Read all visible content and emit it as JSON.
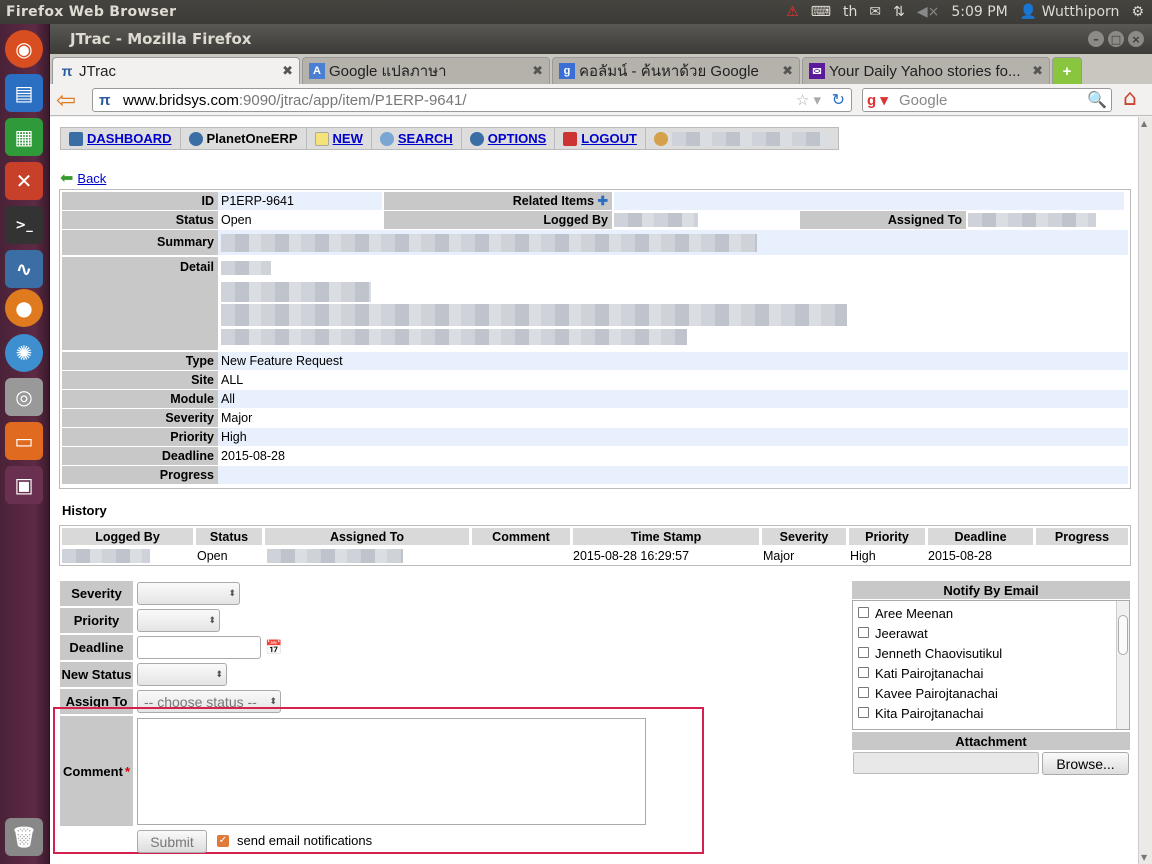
{
  "system": {
    "app_name": "Firefox Web Browser",
    "lang": "th",
    "time": "5:09 PM",
    "user": "Wutthiporn"
  },
  "window": {
    "title": "JTrac - Mozilla Firefox"
  },
  "tabs": [
    {
      "label": "JTrac",
      "icon": "jtrac-icon",
      "active": true
    },
    {
      "label": "Google แปลภาษา",
      "icon": "google-translate-icon"
    },
    {
      "label": "คอลัมน์ - ค้นหาด้วย Google",
      "icon": "google-icon"
    },
    {
      "label": "Your Daily Yahoo stories fo...",
      "icon": "yahoo-icon"
    }
  ],
  "nav": {
    "url_host": "www.bridsys.com",
    "url_path": ":9090/jtrac/app/item/P1ERP-9641/",
    "search_placeholder": "Google"
  },
  "menu": {
    "dashboard": "DASHBOARD",
    "project": "PlanetOneERP",
    "new": "NEW",
    "search": "SEARCH",
    "options": "OPTIONS",
    "logout": "LOGOUT"
  },
  "back": "Back",
  "item": {
    "id_label": "ID",
    "id": "P1ERP-9641",
    "related_label": "Related Items",
    "status_label": "Status",
    "status": "Open",
    "logged_by_label": "Logged By",
    "assigned_to_label": "Assigned To",
    "summary_label": "Summary",
    "detail_label": "Detail",
    "type_label": "Type",
    "type": "New Feature Request",
    "site_label": "Site",
    "site": "ALL",
    "module_label": "Module",
    "module": "All",
    "severity_label": "Severity",
    "severity": "Major",
    "priority_label": "Priority",
    "priority": "High",
    "deadline_label": "Deadline",
    "deadline": "2015-08-28",
    "progress_label": "Progress",
    "progress": ""
  },
  "history": {
    "title": "History",
    "columns": [
      "Logged By",
      "Status",
      "Assigned To",
      "Comment",
      "Time Stamp",
      "Severity",
      "Priority",
      "Deadline",
      "Progress"
    ],
    "rows": [
      {
        "status": "Open",
        "comment": "",
        "timestamp": "2015-08-28 16:29:57",
        "severity": "Major",
        "priority": "High",
        "deadline": "2015-08-28",
        "progress": ""
      }
    ]
  },
  "form": {
    "severity_label": "Severity",
    "priority_label": "Priority",
    "deadline_label": "Deadline",
    "new_status_label": "New Status",
    "assign_to_label": "Assign To",
    "assign_to_value": "-- choose status --",
    "comment_label": "Comment",
    "required_mark": "*",
    "submit": "Submit",
    "send_email": "send email notifications"
  },
  "notify": {
    "title": "Notify By Email",
    "users": [
      "Aree Meenan",
      "Jeerawat",
      "Jenneth Chaovisutikul",
      "Kati Pairojtanachai",
      "Kavee Pairojtanachai",
      "Kita Pairojtanachai"
    ]
  },
  "attachment": {
    "title": "Attachment",
    "browse": "Browse..."
  },
  "colors": {
    "highlight": "#d6204f",
    "label_bg": "#c8c8c8",
    "row_alt": "#e8f0fd"
  }
}
